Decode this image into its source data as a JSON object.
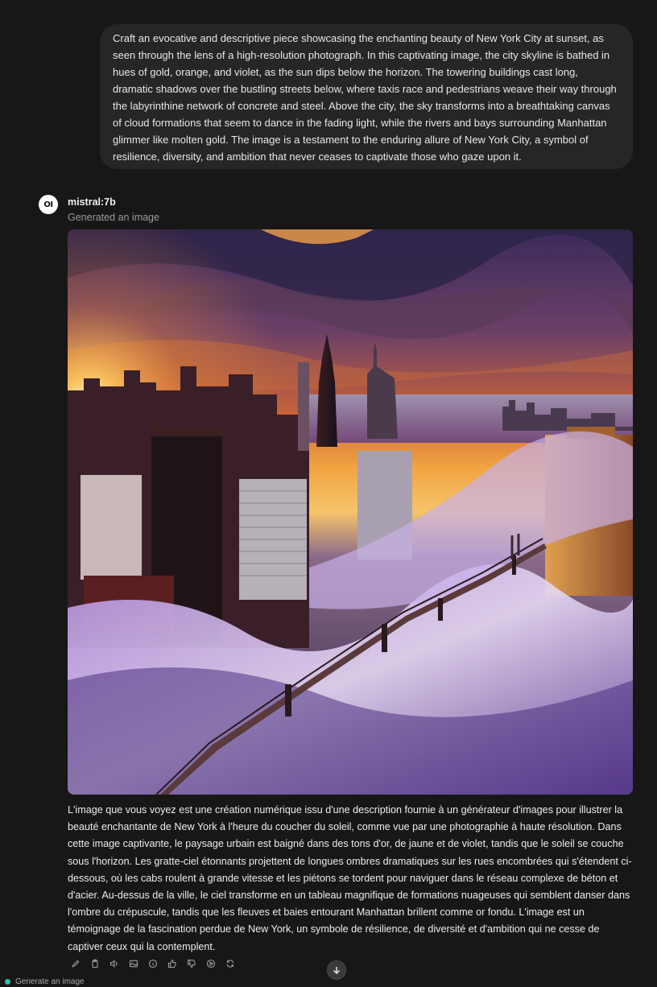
{
  "user_message": "Craft an evocative and descriptive piece showcasing the enchanting beauty of New York City at sunset, as seen through the lens of a high-resolution photograph. In this captivating image, the city skyline is bathed in hues of gold, orange, and violet, as the sun dips below the horizon. The towering buildings cast long, dramatic shadows over the bustling streets below, where taxis race and pedestrians weave their way through the labyrinthine network of concrete and steel. Above the city, the sky transforms into a breathtaking canvas of cloud formations that seem to dance in the fading light, while the rivers and bays surrounding Manhattan glimmer like molten gold. The image is a testament to the enduring allure of New York City, a symbol of resilience, diversity, and ambition that never ceases to captivate those who gaze upon it.",
  "assistant": {
    "avatar_text": "OI",
    "model_name": "mistral:7b",
    "status": "Generated an image",
    "response": "L'image que vous voyez est une création numérique issu d'une description fournie à un générateur d'images pour illustrer la beauté enchantante de New York à l'heure du coucher du soleil, comme vue par une photographie à haute résolution. Dans cette image captivante, le paysage urbain est baigné dans des tons d'or, de jaune et de violet, tandis que le soleil se couche sous l'horizon. Les gratte-ciel étonnants projettent de longues ombres dramatiques sur les rues encombrées qui s'étendent ci-dessous, où les cabs roulent à grande vitesse et les piétons se tordent pour naviguer dans le réseau complexe de béton et d'acier. Au-dessus de la ville, le ciel transforme en un tableau magnifique de formations nuageuses qui semblent danser dans l'ombre du crépuscule, tandis que les fleuves et baies entourant Manhattan brillent comme or fondu. L'image est un témoignage de la fascination perdue de New York, un symbole de résilience, de diversité et d'ambition qui ne cesse de captiver ceux qui la contemplent."
  },
  "actions": [
    "edit-icon",
    "copy-icon",
    "speaker-icon",
    "image-icon",
    "info-icon",
    "thumbs-up-icon",
    "thumbs-down-icon",
    "play-icon",
    "regenerate-icon"
  ],
  "footer_hint": "Generate an image",
  "colors": {
    "background": "#171717",
    "bubble": "#262626",
    "accent_dot": "#22c3b0"
  }
}
